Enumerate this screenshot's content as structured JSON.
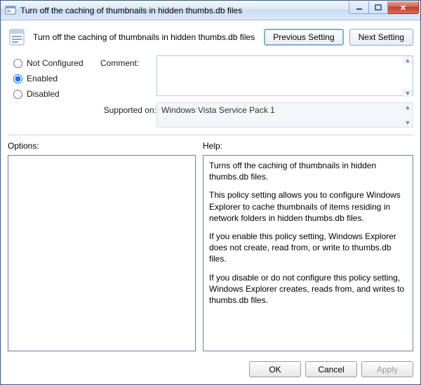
{
  "window": {
    "title": "Turn off the caching of thumbnails in hidden thumbs.db files"
  },
  "header": {
    "policy_title": "Turn off the caching of thumbnails in hidden thumbs.db files",
    "prev_label": "Previous Setting",
    "next_label": "Next Setting"
  },
  "state": {
    "not_configured": "Not Configured",
    "enabled": "Enabled",
    "disabled": "Disabled",
    "selected": "enabled"
  },
  "fields": {
    "comment_label": "Comment:",
    "comment_value": "",
    "supported_label": "Supported on:",
    "supported_value": "Windows Vista Service Pack 1"
  },
  "labels": {
    "options": "Options:",
    "help": "Help:"
  },
  "help": {
    "p1": "Turns off the caching of thumbnails in hidden thumbs.db files.",
    "p2": "This policy setting allows you to configure Windows Explorer to cache thumbnails of items residing in network folders in hidden thumbs.db files.",
    "p3": "If you enable this policy setting, Windows Explorer does not create, read from, or write to thumbs.db files.",
    "p4": "If you disable or do not configure this policy setting, Windows Explorer creates, reads from, and writes to thumbs.db files."
  },
  "footer": {
    "ok": "OK",
    "cancel": "Cancel",
    "apply": "Apply"
  }
}
